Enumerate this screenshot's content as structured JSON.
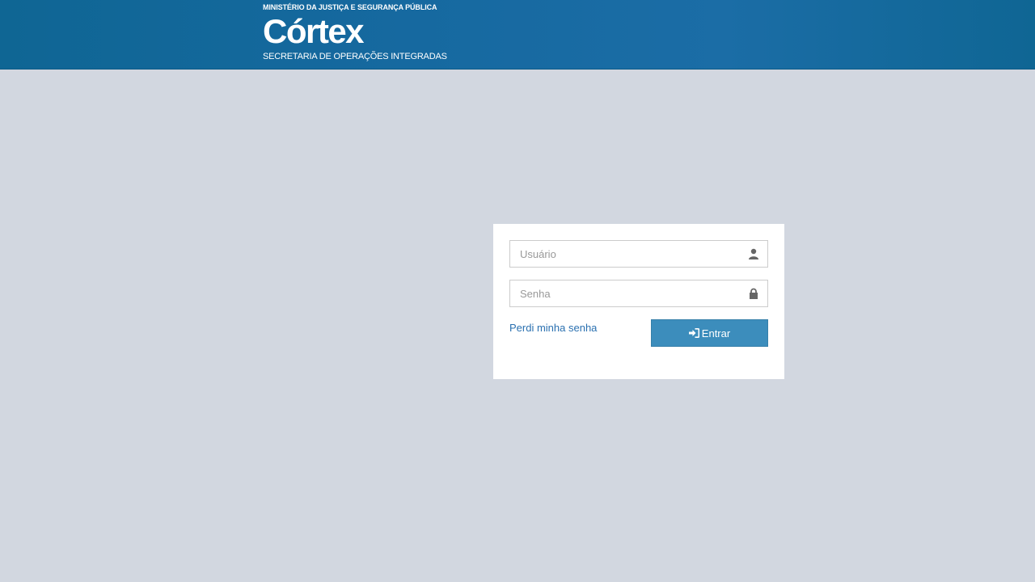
{
  "header": {
    "ministry": "MINISTÉRIO DA JUSTIÇA E SEGURANÇA PÚBLICA",
    "title": "Córtex",
    "subtitle": "SECRETARIA DE OPERAÇÕES INTEGRADAS"
  },
  "login": {
    "username_placeholder": "Usuário",
    "username_value": "",
    "username_icon": "user-icon",
    "password_placeholder": "Senha",
    "password_value": "",
    "password_icon": "lock-icon",
    "forgot_label": "Perdi minha senha",
    "submit_label": "Entrar",
    "submit_icon": "sign-in-icon"
  },
  "colors": {
    "header_bg": "#1669a0",
    "page_bg": "#d2d7e0",
    "button_bg": "#3c8dbc",
    "link": "#2a70b0"
  }
}
